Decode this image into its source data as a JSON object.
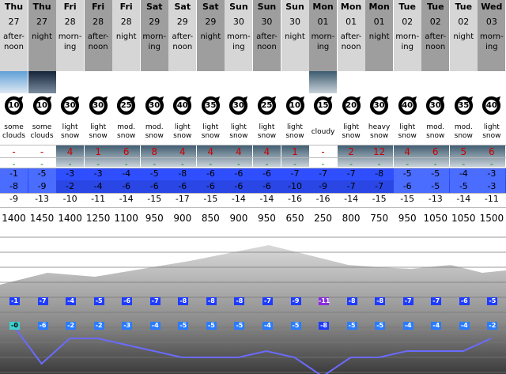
{
  "columns": [
    {
      "day": "Thu",
      "date": "27",
      "period": "after-noon",
      "sky": "sun",
      "wind": "10",
      "weather": "some clouds",
      "snow": "-",
      "rain": "-",
      "freeze": "-",
      "t_max": "-1",
      "t_min": "-8",
      "t_low": "-9",
      "freezing_level": "1400"
    },
    {
      "day": "Thu",
      "date": "27",
      "period": "night",
      "sky": "moon",
      "wind": "10",
      "weather": "some clouds",
      "snow": "-",
      "rain": "-",
      "freeze": "-",
      "t_max": "-5",
      "t_min": "-9",
      "t_low": "-13",
      "freezing_level": "1450"
    },
    {
      "day": "Fri",
      "date": "28",
      "period": "morn-ing",
      "sky": "snow",
      "wind": "30",
      "weather": "light snow",
      "snow": "4",
      "rain": "-",
      "freeze": "-",
      "t_max": "-3",
      "t_min": "-2",
      "t_low": "-10",
      "freezing_level": "1400"
    },
    {
      "day": "Fri",
      "date": "28",
      "period": "after-noon",
      "sky": "snow",
      "wind": "30",
      "weather": "light snow",
      "snow": "1",
      "rain": "-",
      "freeze": "-",
      "t_max": "-3",
      "t_min": "-4",
      "t_low": "-11",
      "freezing_level": "1250"
    },
    {
      "day": "Fri",
      "date": "28",
      "period": "night",
      "sky": "snow",
      "wind": "25",
      "weather": "mod. snow",
      "snow": "6",
      "rain": "-",
      "freeze": "-",
      "t_max": "-4",
      "t_min": "-6",
      "t_low": "-14",
      "freezing_level": "1100"
    },
    {
      "day": "Sat",
      "date": "29",
      "period": "morn-ing",
      "sky": "snow",
      "wind": "30",
      "weather": "mod. snow",
      "snow": "8",
      "rain": "-",
      "freeze": "-",
      "t_max": "-5",
      "t_min": "-6",
      "t_low": "-15",
      "freezing_level": "950"
    },
    {
      "day": "Sat",
      "date": "29",
      "period": "after-noon",
      "sky": "snow",
      "wind": "40",
      "weather": "light snow",
      "snow": "4",
      "rain": "-",
      "freeze": "-",
      "t_max": "-8",
      "t_min": "-6",
      "t_low": "-17",
      "freezing_level": "900"
    },
    {
      "day": "Sat",
      "date": "29",
      "period": "night",
      "sky": "snow",
      "wind": "35",
      "weather": "light snow",
      "snow": "4",
      "rain": "-",
      "freeze": "-",
      "t_max": "-6",
      "t_min": "-6",
      "t_low": "-15",
      "freezing_level": "850"
    },
    {
      "day": "Sun",
      "date": "30",
      "period": "morn-ing",
      "sky": "snow",
      "wind": "30",
      "weather": "light snow",
      "snow": "4",
      "rain": "-",
      "freeze": "-",
      "t_max": "-6",
      "t_min": "-6",
      "t_low": "-14",
      "freezing_level": "900"
    },
    {
      "day": "Sun",
      "date": "30",
      "period": "after-noon",
      "sky": "snow",
      "wind": "25",
      "weather": "light snow",
      "snow": "4",
      "rain": "-",
      "freeze": "-",
      "t_max": "-6",
      "t_min": "-6",
      "t_low": "-14",
      "freezing_level": "950"
    },
    {
      "day": "Sun",
      "date": "30",
      "period": "night",
      "sky": "snow",
      "wind": "10",
      "weather": "light snow",
      "snow": "1",
      "rain": "-",
      "freeze": "-",
      "t_max": "-7",
      "t_min": "-10",
      "t_low": "-16",
      "freezing_level": "650"
    },
    {
      "day": "Mon",
      "date": "01",
      "period": "morn-ing",
      "sky": "cloud",
      "wind": "15",
      "weather": "cloudy",
      "snow": "-",
      "rain": "-",
      "freeze": "-",
      "t_max": "-7",
      "t_min": "-9",
      "t_low": "-16",
      "freezing_level": "250"
    },
    {
      "day": "Mon",
      "date": "01",
      "period": "after-noon",
      "sky": "snow",
      "wind": "20",
      "weather": "light snow",
      "snow": "2",
      "rain": "-",
      "freeze": "-",
      "t_max": "-7",
      "t_min": "-7",
      "t_low": "-14",
      "freezing_level": "800"
    },
    {
      "day": "Mon",
      "date": "01",
      "period": "night",
      "sky": "snow",
      "wind": "30",
      "weather": "heavy snow",
      "snow": "12",
      "rain": "-",
      "freeze": "-",
      "t_max": "-8",
      "t_min": "-7",
      "t_low": "-15",
      "freezing_level": "750"
    },
    {
      "day": "Tue",
      "date": "02",
      "period": "morn-ing",
      "sky": "snow",
      "wind": "40",
      "weather": "light snow",
      "snow": "4",
      "rain": "-",
      "freeze": "-",
      "t_max": "-5",
      "t_min": "-6",
      "t_low": "-15",
      "freezing_level": "950"
    },
    {
      "day": "Tue",
      "date": "02",
      "period": "after-noon",
      "sky": "snow",
      "wind": "30",
      "weather": "mod. snow",
      "snow": "6",
      "rain": "-",
      "freeze": "-",
      "t_max": "-5",
      "t_min": "-5",
      "t_low": "-13",
      "freezing_level": "1050"
    },
    {
      "day": "Tue",
      "date": "02",
      "period": "night",
      "sky": "snow",
      "wind": "35",
      "weather": "mod. snow",
      "snow": "5",
      "rain": "-",
      "freeze": "-",
      "t_max": "-4",
      "t_min": "-5",
      "t_low": "-14",
      "freezing_level": "1050"
    },
    {
      "day": "Wed",
      "date": "03",
      "period": "morn-ing",
      "sky": "snow",
      "wind": "40",
      "weather": "light snow",
      "snow": "6",
      "rain": "-",
      "freeze": "-",
      "t_max": "-3",
      "t_min": "-3",
      "t_low": "-11",
      "freezing_level": "1500"
    }
  ],
  "chart_data": {
    "type": "line",
    "series_upper": [
      "-1",
      "-7",
      "-4",
      "-5",
      "-6",
      "-7",
      "-8",
      "-8",
      "-8",
      "-7",
      "-9",
      "-11",
      "-8",
      "-8",
      "-7",
      "-7",
      "-6",
      "-5"
    ],
    "series_lower": [
      "-0",
      "-6",
      "-2",
      "-2",
      "-3",
      "-4",
      "-5",
      "-5",
      "-5",
      "-4",
      "-5",
      "-8",
      "-5",
      "-5",
      "-4",
      "-4",
      "-4",
      "-2"
    ],
    "line_y": [
      0,
      -6,
      -2,
      -2,
      -3,
      -4,
      -5,
      -5,
      -5,
      -4,
      -5,
      -8,
      -5,
      -5,
      -4,
      -4,
      -4,
      -2
    ]
  },
  "colors": {
    "band_dark": "#2f4fff",
    "band_light": "#5a78ff",
    "line": "#6a6aff",
    "snow": "#cc0000",
    "rain": "#0a8a0a"
  }
}
